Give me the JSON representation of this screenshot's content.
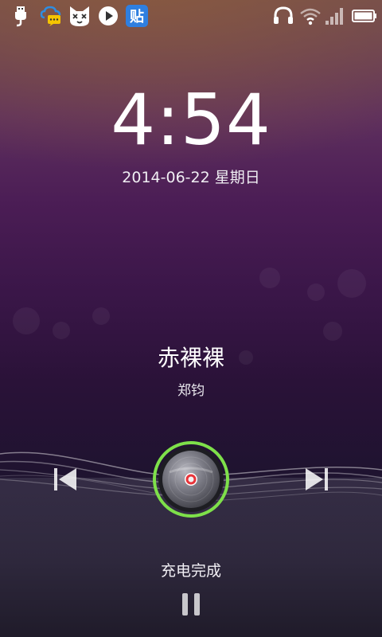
{
  "status_bar": {
    "left_icons": [
      "usb-icon",
      "chat-cloud-icon",
      "cat-app-icon",
      "play-app-icon",
      "tieba-app-icon"
    ],
    "tieba_label": "贴",
    "right_icons": [
      "headphones-icon",
      "wifi-icon",
      "signal-icon",
      "battery-icon"
    ],
    "battery_level": 1.0
  },
  "lockscreen": {
    "time": "4:54",
    "date": "2014-06-22 星期日"
  },
  "music": {
    "title": "赤裸裸",
    "artist": "郑钧",
    "controls": [
      "previous-icon",
      "disc-icon",
      "next-icon"
    ],
    "accent_color": "#7ee04a"
  },
  "footer": {
    "charge_status": "充电完成",
    "pause_icon": "pause-icon"
  }
}
